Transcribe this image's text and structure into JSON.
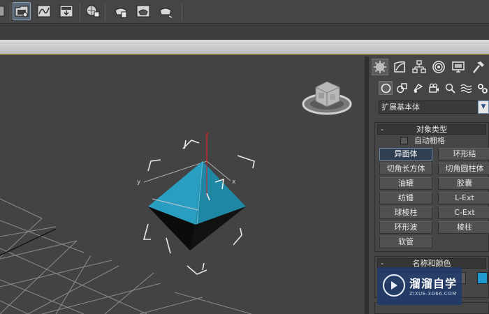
{
  "toolbar": {
    "icons": [
      "render-setup-icon",
      "rendered-frame-window-icon",
      "curve-editor-icon",
      "schematic-view-icon",
      "material-editor-icon",
      "render-production-icon",
      "render-iterative-icon",
      "render-activeshade-icon"
    ]
  },
  "viewport": {
    "axis_x": "x",
    "axis_y": "y",
    "axis_z": "z",
    "object_color": "#2aa0c0"
  },
  "command_panel": {
    "tabs": [
      "create-tab-icon",
      "modify-tab-icon",
      "hierarchy-tab-icon",
      "motion-tab-icon",
      "display-tab-icon",
      "utilities-tab-icon"
    ],
    "subtabs": [
      "geometry-icon",
      "shapes-icon",
      "lights-icon",
      "cameras-icon",
      "helpers-icon",
      "space-warps-icon",
      "systems-icon"
    ],
    "category": "扩展基本体",
    "object_type": {
      "header": "对象类型",
      "minus": "-",
      "autogrid": "自动栅格",
      "buttons": [
        "异面体",
        "环形结",
        "切角长方体",
        "切角圆柱体",
        "油罐",
        "胶囊",
        "纺锤",
        "L-Ext",
        "球棱柱",
        "C-Ext",
        "环形波",
        "棱柱",
        "软管"
      ]
    },
    "name_color": {
      "header": "名称和颜色",
      "minus": "-",
      "swatch_color": "#1e9ad0"
    }
  },
  "watermark": {
    "title": "溜溜自学",
    "subtitle": "ZIXUE.3D66.COM"
  }
}
